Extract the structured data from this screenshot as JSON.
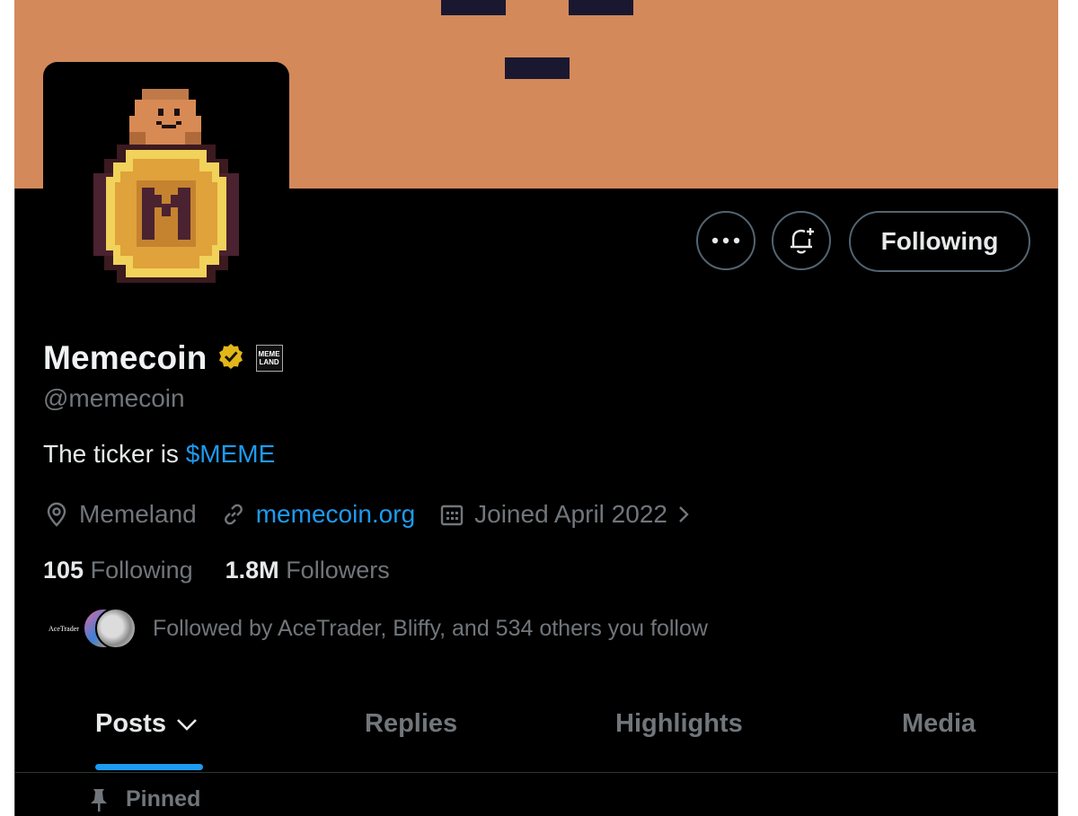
{
  "profile": {
    "name": "Memecoin",
    "handle": "@memecoin",
    "affiliate_badge_line1": "MEME",
    "affiliate_badge_line2": "LAND",
    "bio_prefix": "The ticker is ",
    "bio_cashtag": "$MEME",
    "location": "Memeland",
    "website": "memecoin.org",
    "joined": "Joined April 2022",
    "following_count": "105",
    "following_label": "Following",
    "followers_count": "1.8M",
    "followers_label": "Followers",
    "followed_by": "Followed by AceTrader, Bliffy, and 534 others you follow",
    "mini_avatar_1_text": "AceTrader"
  },
  "actions": {
    "more_icon": "more-horizontal-icon",
    "notify_icon": "bell-plus-icon",
    "follow_label": "Following"
  },
  "tabs": [
    {
      "label": "Posts"
    },
    {
      "label": "Replies"
    },
    {
      "label": "Highlights"
    },
    {
      "label": "Media"
    }
  ],
  "pinned_label": "Pinned",
  "colors": {
    "banner": "#d3895a",
    "accent": "#1d9bf0",
    "verified_gold": "#e2b719",
    "secondary_text": "#71767b"
  }
}
